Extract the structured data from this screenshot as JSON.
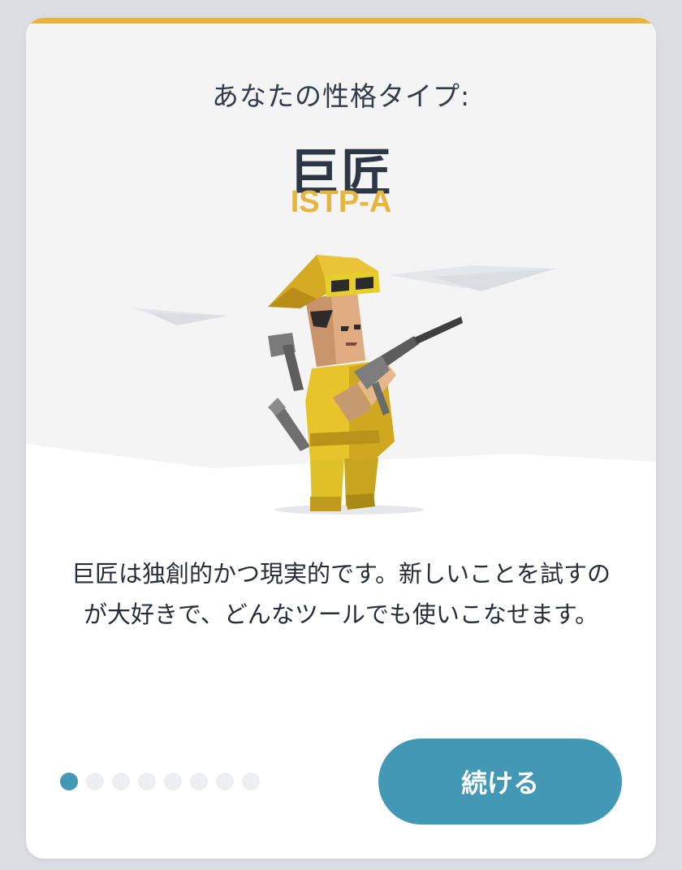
{
  "colors": {
    "accent_yellow": "#e7b53b",
    "accent_blue": "#4298b5",
    "text_dark": "#2d3644",
    "page_bg": "#dcdde2"
  },
  "header": {
    "subtitle": "あなたの性格タイプ:",
    "type_name": "巨匠",
    "type_code": "ISTP-A"
  },
  "illustration": {
    "icon": "virtuoso-character-illustration"
  },
  "description": {
    "line1": "巨匠は独創的かつ現実的です。新しいことを試すの",
    "line2": "が大好きで、どんなツールでも使いこなせます。"
  },
  "pagination": {
    "total": 8,
    "current": 1
  },
  "actions": {
    "continue_label": "続ける"
  }
}
